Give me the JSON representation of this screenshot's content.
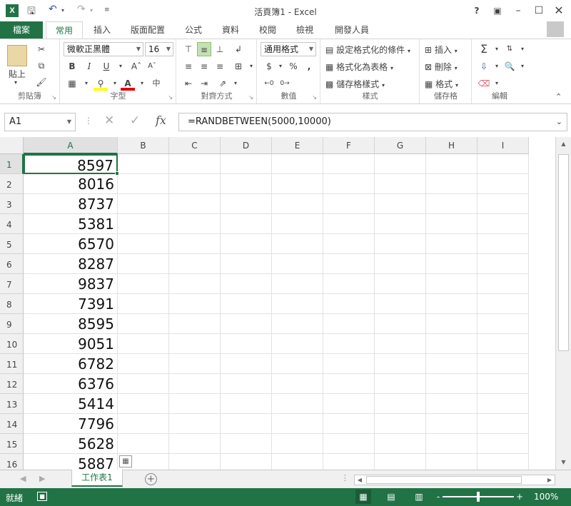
{
  "window": {
    "title": "活頁簿1 - Excel",
    "app_icon": "excel-icon",
    "help": "?",
    "controls": [
      "ribbon-display-icon",
      "minimize-icon",
      "maximize-icon",
      "close-icon"
    ]
  },
  "qat": {
    "save_icon": "save-icon",
    "undo_icon": "undo-icon",
    "redo_icon": "redo-icon",
    "customize_icon": "customize-icon"
  },
  "tabs": {
    "file": "檔案",
    "items": [
      "常用",
      "插入",
      "版面配置",
      "公式",
      "資料",
      "校閱",
      "檢視",
      "開發人員"
    ],
    "active": "常用"
  },
  "ribbon": {
    "clipboard": {
      "label": "剪貼簿",
      "paste": "貼上"
    },
    "font": {
      "label": "字型",
      "name": "微軟正黑體",
      "size": "16",
      "bold": "B",
      "italic": "I",
      "underline": "U"
    },
    "alignment": {
      "label": "對齊方式"
    },
    "number": {
      "label": "數值",
      "format": "通用格式",
      "currency": "$",
      "percent": "%",
      "comma": ","
    },
    "styles": {
      "label": "樣式",
      "conditional": "設定格式化的條件",
      "as_table": "格式化為表格",
      "cell_styles": "儲存格樣式"
    },
    "cells": {
      "label": "儲存格",
      "insert": "插入",
      "delete": "刪除",
      "format": "格式"
    },
    "editing": {
      "label": "編輯",
      "sum": "Σ"
    }
  },
  "formula_bar": {
    "name_box": "A1",
    "formula": "=RANDBETWEEN(5000,10000)",
    "fx": "fx"
  },
  "sheet": {
    "columns": [
      "A",
      "B",
      "C",
      "D",
      "E",
      "F",
      "G",
      "H",
      "I"
    ],
    "rows": [
      "1",
      "2",
      "3",
      "4",
      "5",
      "6",
      "7",
      "8",
      "9",
      "10",
      "11",
      "12",
      "13",
      "14",
      "15",
      "16"
    ],
    "values": [
      "8597",
      "8016",
      "8737",
      "5381",
      "6570",
      "8287",
      "9837",
      "7391",
      "8595",
      "9051",
      "6782",
      "6376",
      "5414",
      "7796",
      "5628",
      "5887"
    ],
    "active_cell": "A1",
    "sheet_tab": "工作表1"
  },
  "status": {
    "ready": "就緒",
    "zoom": "100%",
    "zoom_minus": "-",
    "zoom_plus": "+"
  },
  "colors": {
    "excel_green": "#217346",
    "header_gray": "#f0f0f0",
    "grid_line": "#e2e2e2"
  }
}
